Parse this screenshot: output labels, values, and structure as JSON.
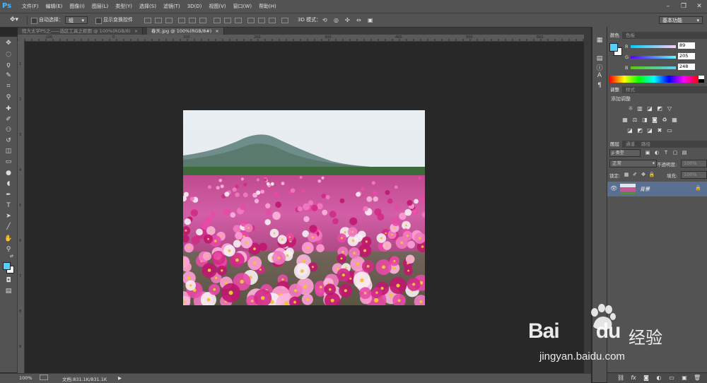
{
  "app": {
    "logo": "Ps"
  },
  "menu": [
    "文件(F)",
    "编辑(E)",
    "图像(I)",
    "图层(L)",
    "类型(Y)",
    "选择(S)",
    "滤镜(T)",
    "3D(D)",
    "视图(V)",
    "窗口(W)",
    "帮助(H)"
  ],
  "window_controls": {
    "minimize": "–",
    "restore": "❐",
    "close": "✕"
  },
  "options": {
    "auto_select_label": "自动选择：",
    "auto_select_value": "组",
    "show_transform_label": "显示变换控件",
    "mode_3d_label": "3D 模式：",
    "workspace": "基本功能"
  },
  "tabs": [
    {
      "label": "程大太学PS之——选区工具之抠图 @ 100%(RGB/8)",
      "close": "×",
      "active": false
    },
    {
      "label": "春天.jpg @ 100%(RGB/8#)",
      "close": "×",
      "active": true
    }
  ],
  "ruler_top": [
    "-100",
    "0",
    "100",
    "200",
    "300",
    "400",
    "500",
    "600",
    "700"
  ],
  "ruler_left": [
    "0",
    "1",
    "2",
    "3",
    "4",
    "5",
    "6",
    "7",
    "8",
    "9"
  ],
  "tools": [
    {
      "name": "move-tool-icon",
      "glyph": "✥"
    },
    {
      "name": "marquee-tool-icon",
      "glyph": "◌"
    },
    {
      "name": "lasso-tool-icon",
      "glyph": "ϙ"
    },
    {
      "name": "quick-select-tool-icon",
      "glyph": "✎"
    },
    {
      "name": "crop-tool-icon",
      "glyph": "⌗"
    },
    {
      "name": "eyedropper-tool-icon",
      "glyph": "⚲"
    },
    {
      "name": "healing-brush-tool-icon",
      "glyph": "✚"
    },
    {
      "name": "brush-tool-icon",
      "glyph": "✐"
    },
    {
      "name": "clone-stamp-tool-icon",
      "glyph": "⚇"
    },
    {
      "name": "history-brush-tool-icon",
      "glyph": "↺"
    },
    {
      "name": "eraser-tool-icon",
      "glyph": "◫"
    },
    {
      "name": "gradient-tool-icon",
      "glyph": "▭"
    },
    {
      "name": "blur-tool-icon",
      "glyph": "●"
    },
    {
      "name": "dodge-tool-icon",
      "glyph": "◖"
    },
    {
      "name": "pen-tool-icon",
      "glyph": "✒"
    },
    {
      "name": "type-tool-icon",
      "glyph": "T"
    },
    {
      "name": "path-select-tool-icon",
      "glyph": "➤"
    },
    {
      "name": "line-tool-icon",
      "glyph": "╱"
    },
    {
      "name": "hand-tool-icon",
      "glyph": "✋"
    },
    {
      "name": "zoom-tool-icon",
      "glyph": "⚲"
    },
    {
      "name": "swap-colors-icon",
      "glyph": "⇄"
    },
    {
      "name": "quick-mask-icon",
      "glyph": "◘"
    },
    {
      "name": "screen-mode-icon",
      "glyph": "▤"
    }
  ],
  "status": {
    "zoom": "100%",
    "doc": "文档:831.1K/831.1K",
    "arrow": "▶"
  },
  "color_panel": {
    "tabs": [
      "颜色",
      "色板"
    ],
    "r_label": "R",
    "g_label": "G",
    "b_label": "B",
    "r": "89",
    "g": "205",
    "b": "248",
    "foreground": "#59cdf8",
    "background": "#ffffff"
  },
  "adjust_panel": {
    "tabs": [
      "调整",
      "样式"
    ],
    "title": "添加调整"
  },
  "layers_panel": {
    "tabs": [
      "图层",
      "通道",
      "路径"
    ],
    "kind_label": "ρ 类型",
    "blend_mode": "正常",
    "opacity_label": "不透明度:",
    "opacity": "100%",
    "lock_label": "锁定:",
    "fill_label": "填充:",
    "fill": "100%",
    "layer_name": "背景",
    "footer_icons": [
      "link-icon",
      "fx-icon",
      "mask-icon",
      "adjustment-icon",
      "folder-icon",
      "new-layer-icon",
      "trash-icon"
    ]
  },
  "watermark": {
    "brand": "Bai",
    "brand2": "du",
    "cn": "经验",
    "url": "jingyan.baidu.com"
  }
}
